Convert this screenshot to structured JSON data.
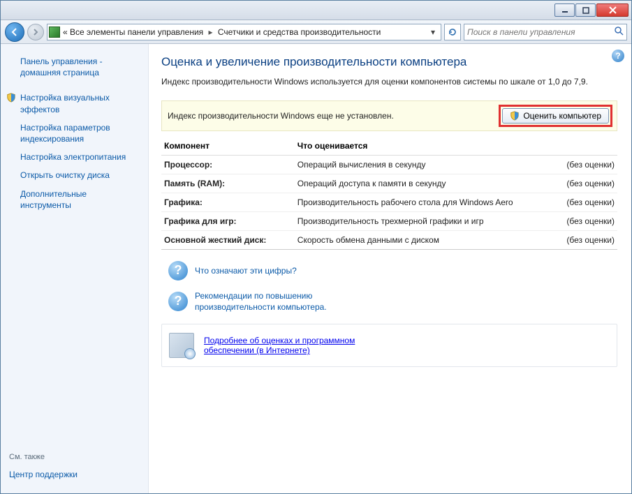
{
  "breadcrumb": {
    "prefix": "«",
    "level1": "Все элементы панели управления",
    "level2": "Счетчики и средства производительности"
  },
  "search": {
    "placeholder": "Поиск в панели управления"
  },
  "sidebar": {
    "home": "Панель управления - домашняя страница",
    "items": [
      "Настройка визуальных эффектов",
      "Настройка параметров индексирования",
      "Настройка электропитания",
      "Открыть очистку диска",
      "Дополнительные инструменты"
    ],
    "see_also_heading": "См. также",
    "see_also_link": "Центр поддержки"
  },
  "main": {
    "title": "Оценка и увеличение производительности компьютера",
    "intro": "Индекс производительности Windows используется для оценки компонентов системы по шкале от 1,0 до 7,9.",
    "alert_text": "Индекс производительности Windows еще не установлен.",
    "rate_button": "Оценить компьютер",
    "table": {
      "head_component": "Компонент",
      "head_what": "Что оценивается",
      "rows": [
        {
          "name": "Процессор:",
          "what": "Операций вычисления в секунду",
          "score": "(без оценки)"
        },
        {
          "name": "Память (RAM):",
          "what": "Операций доступа к памяти в секунду",
          "score": "(без оценки)"
        },
        {
          "name": "Графика:",
          "what": "Производительность рабочего стола для Windows Aero",
          "score": "(без оценки)"
        },
        {
          "name": "Графика для игр:",
          "what": "Производительность трехмерной графики и игр",
          "score": "(без оценки)"
        },
        {
          "name": "Основной жесткий диск:",
          "what": "Скорость обмена данными с диском",
          "score": "(без оценки)"
        }
      ]
    },
    "link1": "Что означают эти цифры?",
    "link2": "Рекомендации по повышению производительности компьютера.",
    "soft_link": "Подробнее об оценках и программном обеспечении (в Интернете)"
  }
}
